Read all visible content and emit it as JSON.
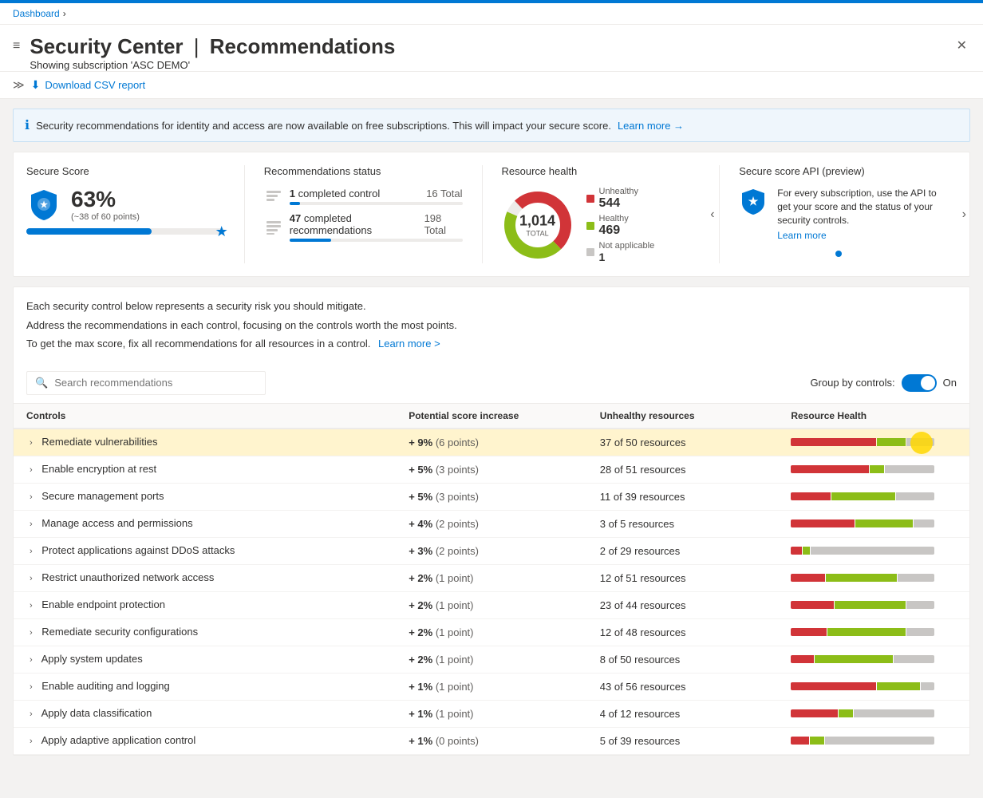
{
  "topbar": {
    "color": "#0078d4"
  },
  "breadcrumb": {
    "dashboard": "Dashboard",
    "separator": "›"
  },
  "header": {
    "icon_lines": "≡",
    "title": "Security Center",
    "separator": "|",
    "subtitle": "Recommendations",
    "subscription": "Showing subscription 'ASC DEMO'",
    "close_label": "✕"
  },
  "toolbar": {
    "nav_arrows": "≫",
    "download_label": "Download CSV report"
  },
  "banner": {
    "text": "Security recommendations for identity and access are now available on free subscriptions. This will impact your secure score.",
    "learn_more": "Learn more →"
  },
  "secure_score": {
    "title": "Secure Score",
    "percentage": "63%",
    "detail": "(~38 of 60 points)",
    "progress_width": "63"
  },
  "recommendations_status": {
    "title": "Recommendations status",
    "completed_controls": "1",
    "completed_controls_label": "completed control",
    "controls_total": "16 Total",
    "controls_progress": "6",
    "completed_recs": "47",
    "completed_recs_label": "completed recommendations",
    "recs_total": "198 Total",
    "recs_progress": "24"
  },
  "resource_health": {
    "title": "Resource health",
    "total": "1,014",
    "total_label": "TOTAL",
    "unhealthy_label": "Unhealthy",
    "unhealthy_count": "544",
    "healthy_label": "Healthy",
    "healthy_count": "469",
    "na_label": "Not applicable",
    "na_count": "1",
    "unhealthy_color": "#d13438",
    "healthy_color": "#8cbd18",
    "unhealthy_pct": 53,
    "healthy_pct": 46
  },
  "secure_api": {
    "title": "Secure score API (preview)",
    "description": "For every subscription, use the API to get your score and the status of your security controls.",
    "learn_more": "Learn more",
    "dot_color": "#0078d4"
  },
  "table_section": {
    "desc1": "Each security control below represents a security risk you should mitigate.",
    "desc2": "Address the recommendations in each control, focusing on the controls worth the most points.",
    "desc3": "To get the max score, fix all recommendations for all resources in a control.",
    "learn_more": "Learn more >",
    "search_placeholder": "Search recommendations",
    "group_by_label": "Group by controls:",
    "toggle_state": "On",
    "col_controls": "Controls",
    "col_score": "Potential score increase",
    "col_unhealthy": "Unhealthy resources",
    "col_health": "Resource Health"
  },
  "controls": [
    {
      "name": "Remediate vulnerabilities",
      "score": "+ 9%",
      "points": "(6 points)",
      "unhealthy": "37 of 50 resources",
      "red_pct": 60,
      "green_pct": 20,
      "gray_pct": 20,
      "highlight": true
    },
    {
      "name": "Enable encryption at rest",
      "score": "+ 5%",
      "points": "(3 points)",
      "unhealthy": "28 of 51 resources",
      "red_pct": 55,
      "green_pct": 10,
      "gray_pct": 35,
      "highlight": false
    },
    {
      "name": "Secure management ports",
      "score": "+ 5%",
      "points": "(3 points)",
      "unhealthy": "11 of 39 resources",
      "red_pct": 28,
      "green_pct": 45,
      "gray_pct": 27,
      "highlight": false
    },
    {
      "name": "Manage access and permissions",
      "score": "+ 4%",
      "points": "(2 points)",
      "unhealthy": "3 of 5 resources",
      "red_pct": 45,
      "green_pct": 40,
      "gray_pct": 15,
      "highlight": false
    },
    {
      "name": "Protect applications against DDoS attacks",
      "score": "+ 3%",
      "points": "(2 points)",
      "unhealthy": "2 of 29 resources",
      "red_pct": 8,
      "green_pct": 5,
      "gray_pct": 87,
      "highlight": false
    },
    {
      "name": "Restrict unauthorized network access",
      "score": "+ 2%",
      "points": "(1 point)",
      "unhealthy": "12 of 51 resources",
      "red_pct": 24,
      "green_pct": 50,
      "gray_pct": 26,
      "highlight": false
    },
    {
      "name": "Enable endpoint protection",
      "score": "+ 2%",
      "points": "(1 point)",
      "unhealthy": "23 of 44 resources",
      "red_pct": 30,
      "green_pct": 50,
      "gray_pct": 20,
      "highlight": false
    },
    {
      "name": "Remediate security configurations",
      "score": "+ 2%",
      "points": "(1 point)",
      "unhealthy": "12 of 48 resources",
      "red_pct": 25,
      "green_pct": 55,
      "gray_pct": 20,
      "highlight": false
    },
    {
      "name": "Apply system updates",
      "score": "+ 2%",
      "points": "(1 point)",
      "unhealthy": "8 of 50 resources",
      "red_pct": 16,
      "green_pct": 55,
      "gray_pct": 29,
      "highlight": false
    },
    {
      "name": "Enable auditing and logging",
      "score": "+ 1%",
      "points": "(1 point)",
      "unhealthy": "43 of 56 resources",
      "red_pct": 60,
      "green_pct": 30,
      "gray_pct": 10,
      "highlight": false
    },
    {
      "name": "Apply data classification",
      "score": "+ 1%",
      "points": "(1 point)",
      "unhealthy": "4 of 12 resources",
      "red_pct": 33,
      "green_pct": 10,
      "gray_pct": 57,
      "highlight": false
    },
    {
      "name": "Apply adaptive application control",
      "score": "+ 1%",
      "points": "(0 points)",
      "unhealthy": "5 of 39 resources",
      "red_pct": 13,
      "green_pct": 10,
      "gray_pct": 77,
      "highlight": false
    }
  ]
}
